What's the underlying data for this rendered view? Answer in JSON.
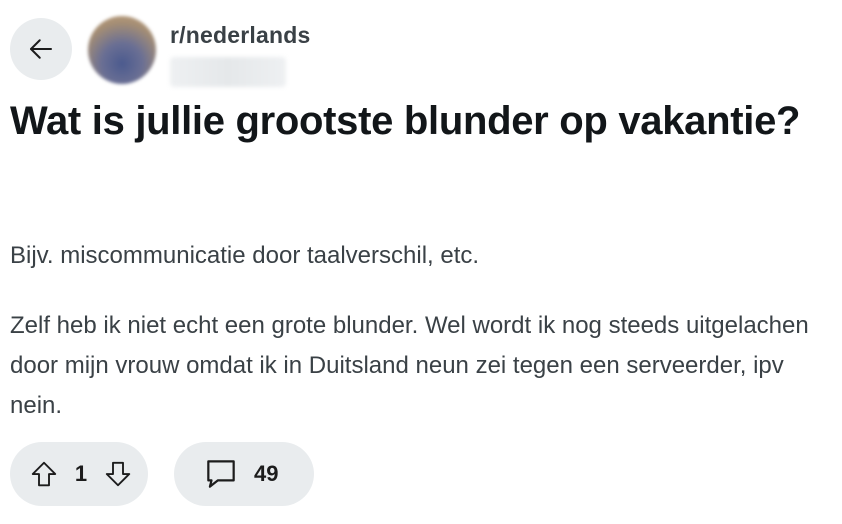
{
  "post": {
    "subreddit": "r/nederlands",
    "title": "Wat is jullie grootste blunder op vakantie?",
    "body": [
      "Bijv. miscommunicatie door taalverschil, etc.",
      "Zelf heb ik niet echt een grote blunder. Wel wordt ik nog steeds uitgelachen door mijn vrouw omdat ik in Duitsland neun zei tegen een serveerder, ipv nein."
    ]
  },
  "actions": {
    "vote_count": "1",
    "comment_count": "49"
  },
  "icons": {
    "back": "arrow-left-icon",
    "upvote": "arrow-up-icon",
    "downvote": "arrow-down-icon",
    "comments": "speech-bubble-icon"
  },
  "colors": {
    "pill_background": "#e9ecee",
    "title_text": "#121619",
    "body_text": "#3a4146"
  }
}
